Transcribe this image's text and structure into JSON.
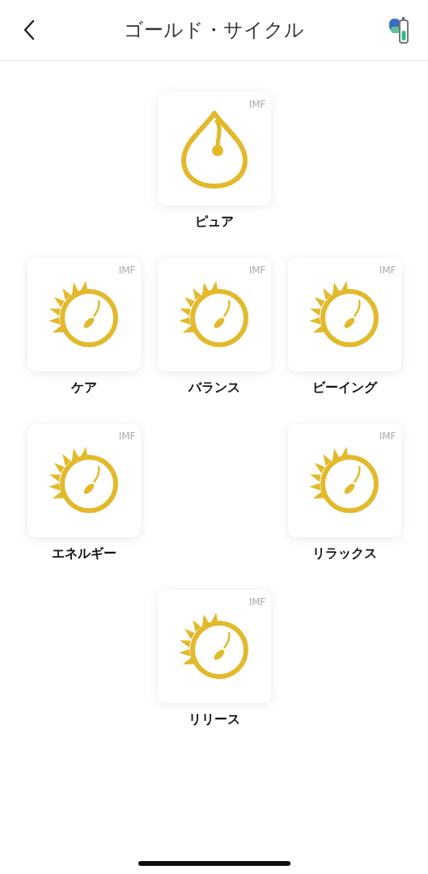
{
  "header": {
    "title": "ゴールド・サイクル"
  },
  "grid": [
    [
      {
        "kind": "empty"
      },
      {
        "kind": "drop",
        "badge": "IMF",
        "label": "ピュア"
      },
      {
        "kind": "empty"
      }
    ],
    [
      {
        "kind": "sun",
        "badge": "IMF",
        "label": "ケア"
      },
      {
        "kind": "sun",
        "badge": "IMF",
        "label": "バランス"
      },
      {
        "kind": "sun",
        "badge": "IMF",
        "label": "ビーイング"
      }
    ],
    [
      {
        "kind": "sun",
        "badge": "IMF",
        "label": "エネルギー"
      },
      {
        "kind": "empty"
      },
      {
        "kind": "sun",
        "badge": "IMF",
        "label": "リラックス"
      }
    ],
    [
      {
        "kind": "empty"
      },
      {
        "kind": "sun",
        "badge": "IMF",
        "label": "リリース"
      },
      {
        "kind": "empty"
      }
    ]
  ]
}
